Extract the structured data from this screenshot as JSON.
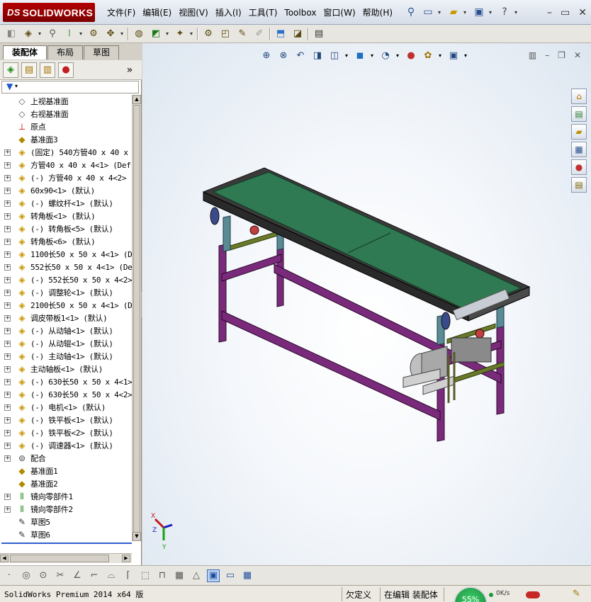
{
  "app": {
    "logo_text": "SOLIDWORKS",
    "logo_prefix": "DS"
  },
  "menu": [
    "文件(F)",
    "编辑(E)",
    "视图(V)",
    "插入(I)",
    "工具(T)",
    "Toolbox",
    "窗口(W)",
    "帮助(H)"
  ],
  "left_panel": {
    "tabs": [
      "装配体",
      "布局",
      "草图"
    ],
    "active_tab": 0,
    "more_label": "»"
  },
  "tree": [
    {
      "label": "上视基准面",
      "icon": "plane-icon",
      "expandable": false
    },
    {
      "label": "右视基准面",
      "icon": "plane-icon",
      "expandable": false
    },
    {
      "label": "原点",
      "icon": "origin-icon",
      "expandable": false
    },
    {
      "label": "基准面3",
      "icon": "plane-yellow-icon",
      "expandable": false
    },
    {
      "label": "(固定) 540方管40 x 40 x",
      "icon": "part-icon",
      "expandable": true
    },
    {
      "label": "方管40 x 40 x 4<1> (Def",
      "icon": "part-icon",
      "expandable": true
    },
    {
      "label": "(-) 方管40 x 40 x 4<2>",
      "icon": "part-icon",
      "expandable": true
    },
    {
      "label": "60x90<1> (默认)",
      "icon": "part-icon",
      "expandable": true
    },
    {
      "label": "(-) 螺纹杆<1> (默认)",
      "icon": "part-icon",
      "expandable": true
    },
    {
      "label": "转角板<1> (默认)",
      "icon": "part-icon",
      "expandable": true
    },
    {
      "label": "(-) 转角板<5> (默认)",
      "icon": "part-icon",
      "expandable": true
    },
    {
      "label": "转角板<6> (默认)",
      "icon": "part-icon",
      "expandable": true
    },
    {
      "label": "1100长50 x 50 x 4<1> (D",
      "icon": "part-icon",
      "expandable": true
    },
    {
      "label": "552长50 x 50 x 4<1> (De",
      "icon": "part-icon",
      "expandable": true
    },
    {
      "label": "(-) 552长50 x 50 x 4<2>",
      "icon": "part-icon",
      "expandable": true
    },
    {
      "label": "(-) 调整轮<1> (默认)",
      "icon": "part-icon",
      "expandable": true
    },
    {
      "label": "2100长50 x 50 x 4<1> (D",
      "icon": "part-icon",
      "expandable": true
    },
    {
      "label": "调皮带板1<1> (默认)",
      "icon": "part-icon",
      "expandable": true
    },
    {
      "label": "(-) 从动轴<1> (默认)",
      "icon": "part-icon",
      "expandable": true
    },
    {
      "label": "(-) 从动辊<1> (默认)",
      "icon": "part-icon",
      "expandable": true
    },
    {
      "label": "(-) 主动轴<1> (默认)",
      "icon": "part-icon",
      "expandable": true
    },
    {
      "label": "主动轴板<1> (默认)",
      "icon": "part-icon",
      "expandable": true
    },
    {
      "label": "(-) 630长50 x 50 x 4<1>",
      "icon": "part-icon",
      "expandable": true
    },
    {
      "label": "(-) 630长50 x 50 x 4<2>",
      "icon": "part-icon",
      "expandable": true
    },
    {
      "label": "(-) 电机<1> (默认)",
      "icon": "part-icon",
      "expandable": true
    },
    {
      "label": "(-) 铁平板<1> (默认)",
      "icon": "part-icon",
      "expandable": true
    },
    {
      "label": "(-) 铁平板<2> (默认)",
      "icon": "part-icon",
      "expandable": true
    },
    {
      "label": "(-) 调速器<1> (默认)",
      "icon": "part-icon",
      "expandable": true
    },
    {
      "label": "配合",
      "icon": "mate-icon",
      "expandable": true
    },
    {
      "label": "基准面1",
      "icon": "plane-yellow-icon",
      "expandable": false
    },
    {
      "label": "基准面2",
      "icon": "plane-yellow-icon",
      "expandable": false
    },
    {
      "label": "镜向零部件1",
      "icon": "mirror-icon",
      "expandable": true
    },
    {
      "label": "镜向零部件2",
      "icon": "mirror-icon",
      "expandable": true
    },
    {
      "label": "草图5",
      "icon": "sketch-icon",
      "expandable": false
    },
    {
      "label": "草图6",
      "icon": "sketch-icon",
      "expandable": false
    }
  ],
  "triad": {
    "x": "X",
    "y": "Y",
    "z": "Z"
  },
  "status": {
    "product": "SolidWorks Premium 2014 x64 版",
    "definition": "欠定义",
    "mode": "在编辑 装配体",
    "gauge": "55%",
    "net_speed": "0K/s"
  },
  "colors": {
    "belt": "#2f7a52",
    "frame": "#7a2a7a",
    "bracket": "#5a8a94",
    "rail": "#3a3a3a"
  }
}
